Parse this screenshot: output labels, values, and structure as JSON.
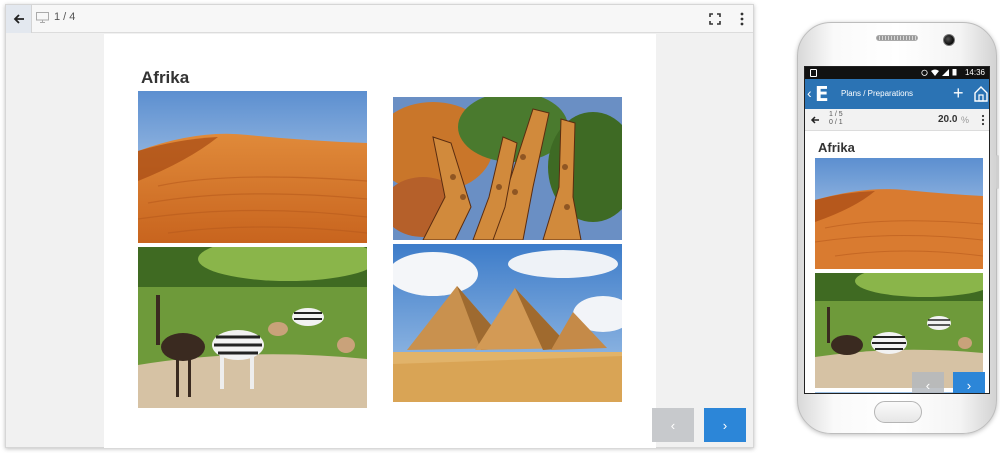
{
  "desktop": {
    "slide_counter": "1 / 4",
    "slide_title": "Afrika",
    "icons": {
      "back": "arrow-left-icon",
      "monitor": "monitor-icon",
      "fullscreen": "fullscreen-icon",
      "menu": "kebab-menu-icon"
    },
    "nav": {
      "prev_label": "‹",
      "next_label": "›"
    }
  },
  "mobile": {
    "status_time": "14:36",
    "app_title": "Plans / Preparations",
    "app_logo": "E",
    "progress_slides": "1 / 5",
    "progress_tasks": "0 / 1",
    "progress_percent": "20.0",
    "progress_unit": "%",
    "slide_title": "Afrika",
    "nav": {
      "prev_label": "‹",
      "next_label": "›"
    }
  },
  "colors": {
    "accent": "#2c86d8",
    "appbar": "#2b73b4",
    "disabled": "#c7c9cc"
  }
}
